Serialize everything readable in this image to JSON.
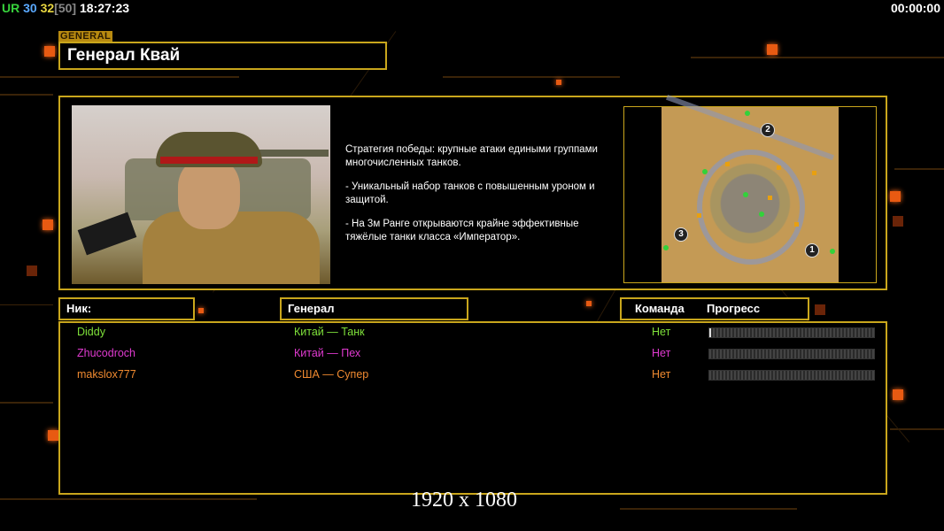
{
  "hud": {
    "ur_label": "UR",
    "n1": "30",
    "n2": "32",
    "bracket": "[50]",
    "clock": "18:27:23",
    "timer": "00:00:00"
  },
  "general": {
    "tag": "GENERAL",
    "name": "Генерал Квай"
  },
  "description": [
    "Стратегия победы: крупные атаки едиными группами многочисленных танков.",
    "- Уникальный набор танков с повышенным уроном и защитой.",
    "- На 3м Ранге открываются крайне эффективные тяжёлые танки класса «Император»."
  ],
  "map": {
    "start_positions": [
      "1",
      "2",
      "3"
    ]
  },
  "columns": {
    "nick": "Ник:",
    "general": "Генерал",
    "team": "Команда",
    "progress": "Прогресс"
  },
  "players": [
    {
      "nick": "Diddy",
      "general": "Китай — Танк",
      "team": "Нет",
      "color": "#7ee03a",
      "progress": 0.01
    },
    {
      "nick": "Zhucodroch",
      "general": "Китай — Пех",
      "team": "Нет",
      "color": "#e03ad0",
      "progress": 0
    },
    {
      "nick": "makslox777",
      "general": "США — Супер",
      "team": "Нет",
      "color": "#f08a30",
      "progress": 0
    }
  ],
  "resolution": "1920 x 1080",
  "colors": {
    "frame": "#c9a61c",
    "accent": "#e85a12"
  }
}
